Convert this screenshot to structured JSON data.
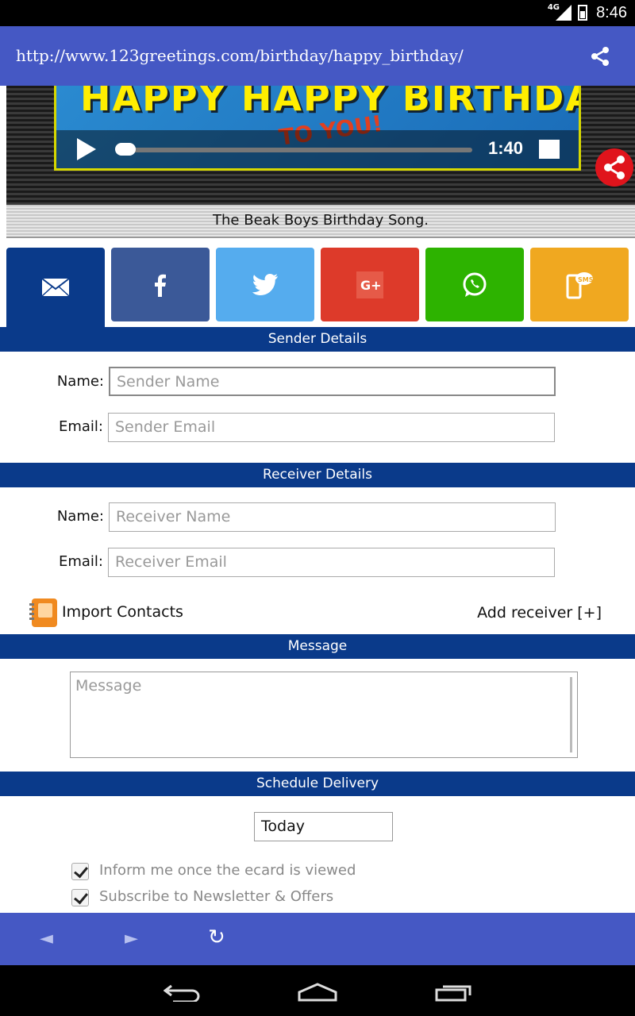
{
  "status": {
    "time": "8:46",
    "network": "4G"
  },
  "browser": {
    "url": "http://www.123greetings.com/birthday/happy_birthday/"
  },
  "video": {
    "title_text": "HAPPY HAPPY BIRTHDAY",
    "subtitle_text": "TO YOU!",
    "duration": "1:40",
    "progress": 0.0
  },
  "caption": "The Beak Boys Birthday Song.",
  "share_buttons": [
    {
      "name": "email",
      "color": "#0a3a8a"
    },
    {
      "name": "facebook",
      "color": "#3b5998"
    },
    {
      "name": "twitter",
      "color": "#55acee"
    },
    {
      "name": "google-plus",
      "color": "#dd3a2a"
    },
    {
      "name": "whatsapp",
      "color": "#2db300"
    },
    {
      "name": "sms",
      "color": "#f0a820"
    }
  ],
  "sender": {
    "header": "Sender Details",
    "name_label": "Name:",
    "name_placeholder": "Sender Name",
    "email_label": "Email:",
    "email_placeholder": "Sender Email"
  },
  "receiver": {
    "header": "Receiver Details",
    "name_label": "Name:",
    "name_placeholder": "Receiver Name",
    "email_label": "Email:",
    "email_placeholder": "Receiver Email",
    "import_label": "Import Contacts",
    "add_label": "Add receiver [+]"
  },
  "message": {
    "header": "Message",
    "placeholder": "Message"
  },
  "schedule": {
    "header": "Schedule Delivery",
    "selected": "Today",
    "inform_label": "Inform me once the ecard is viewed",
    "subscribe_label": "Subscribe to Newsletter & Offers"
  },
  "toolbar": {
    "back": "◄",
    "forward": "►",
    "reload": "↻"
  }
}
